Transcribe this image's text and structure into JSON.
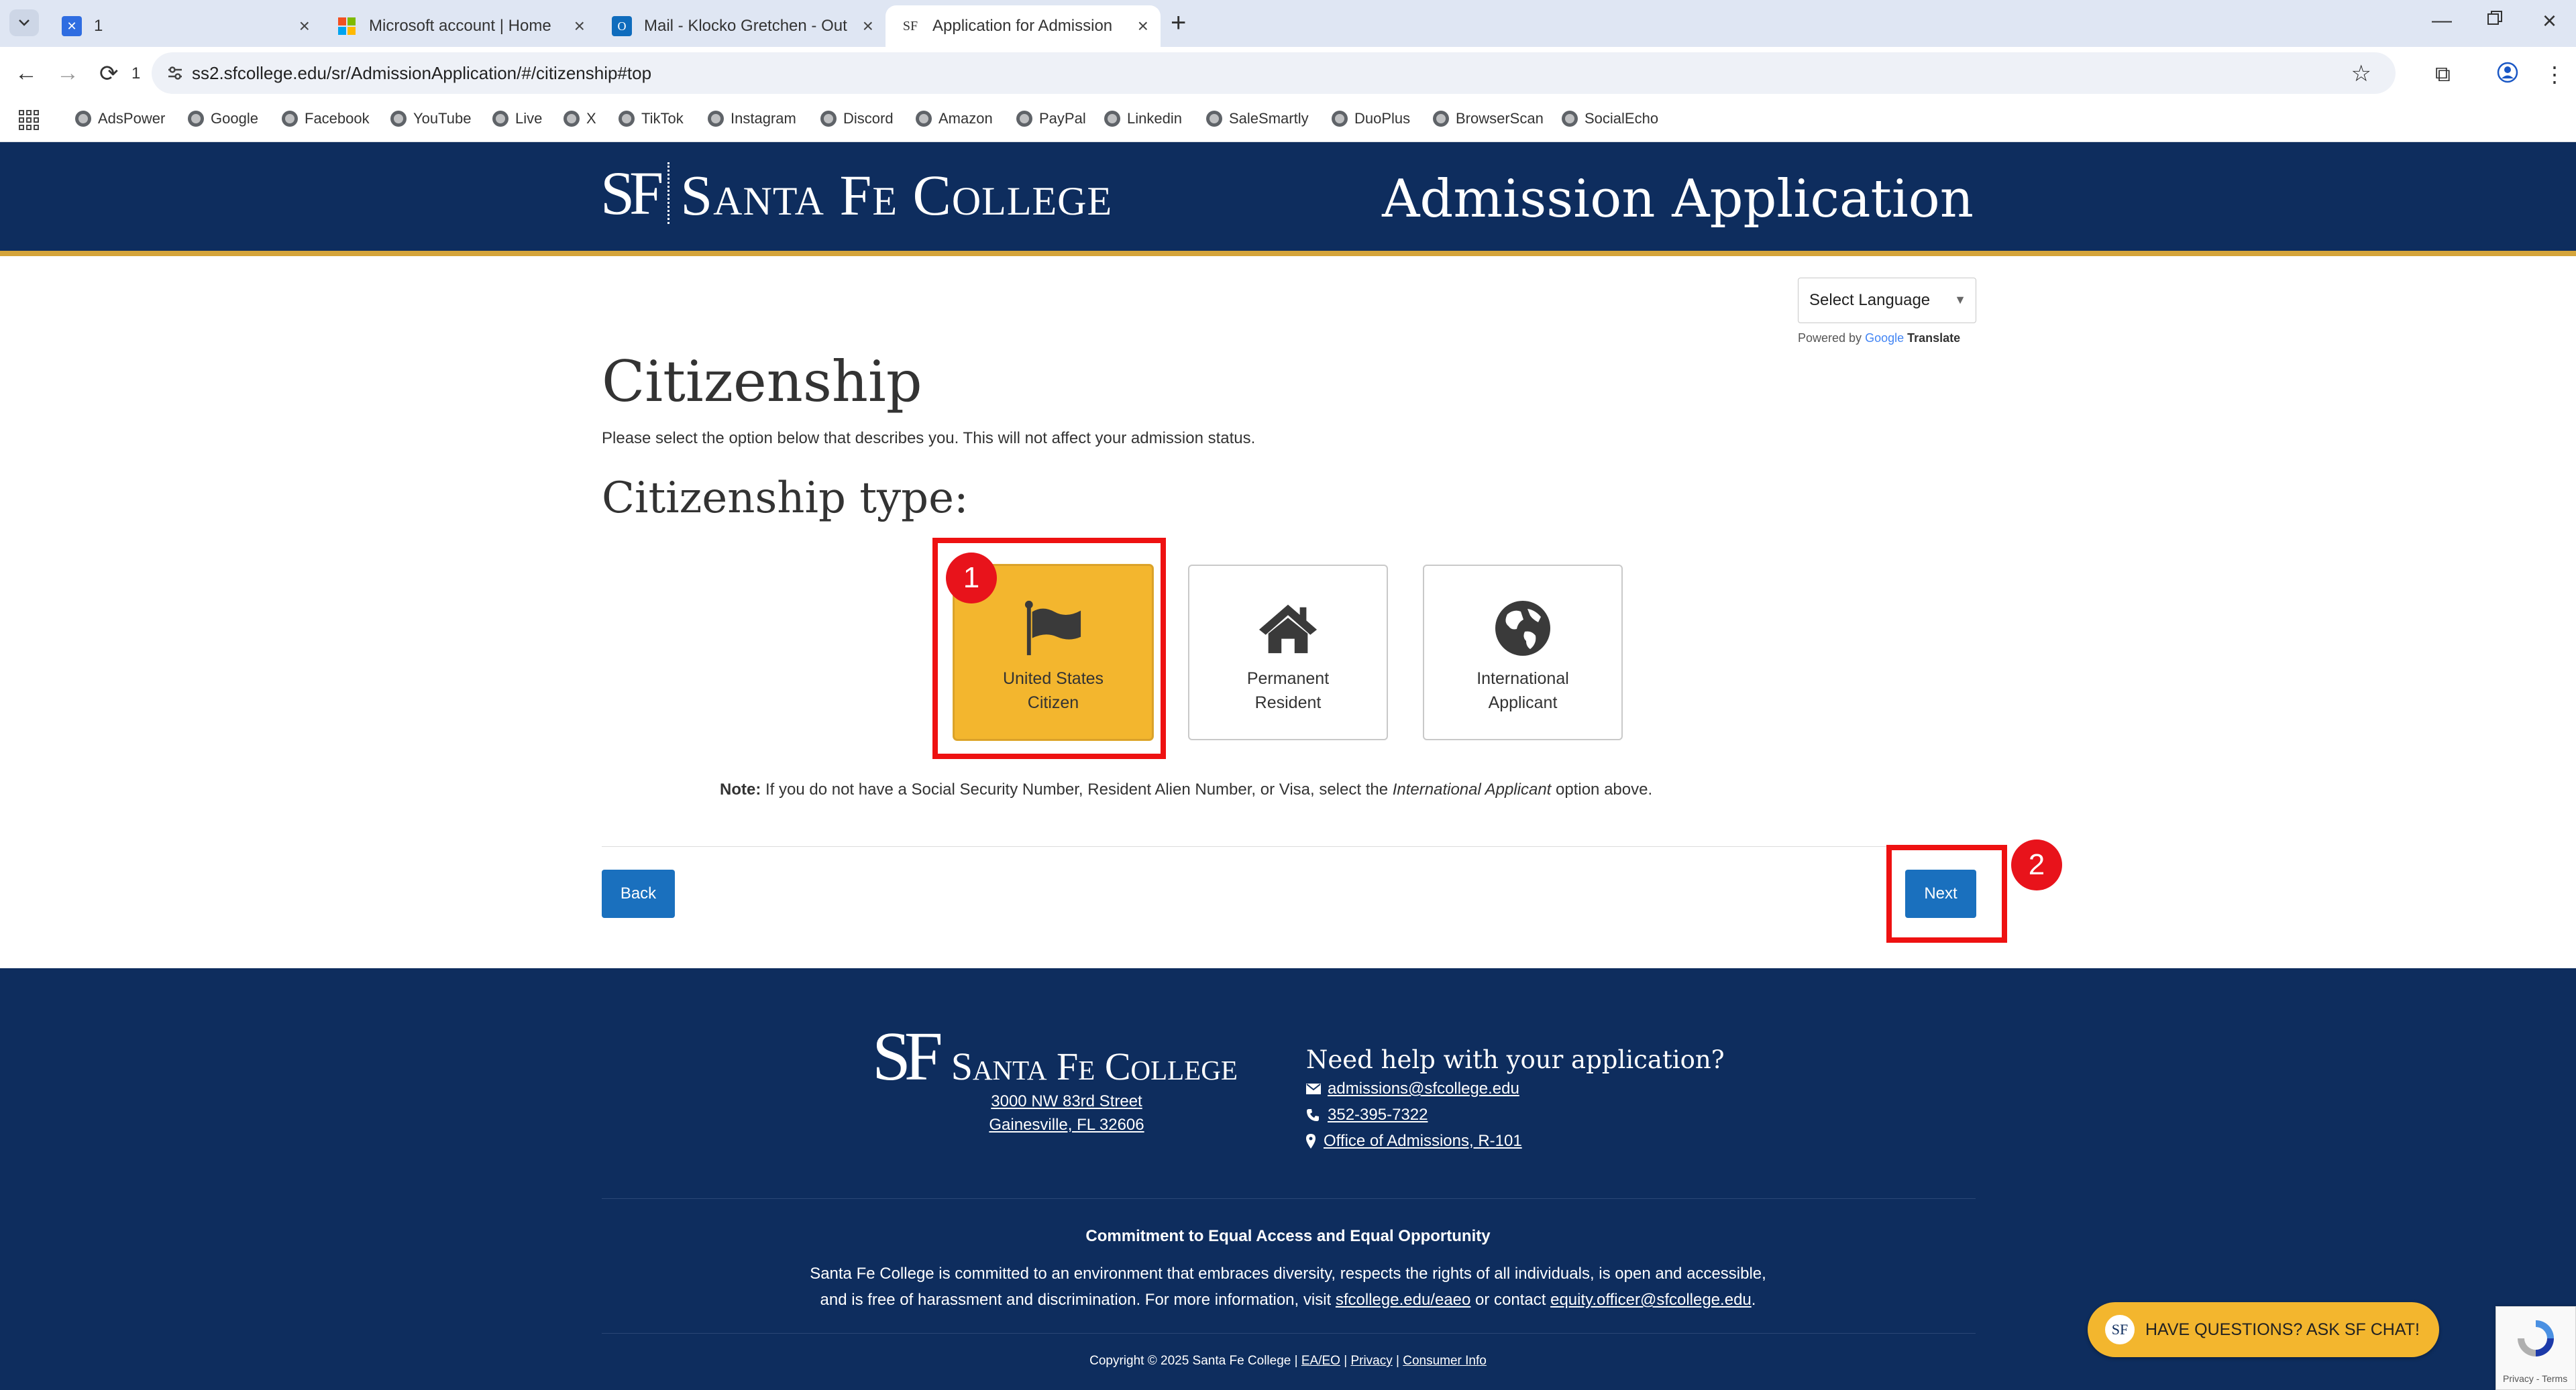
{
  "browser": {
    "tabs": [
      {
        "label": "1",
        "favicon": "app-icon"
      },
      {
        "label": "Microsoft account | Home",
        "favicon": "microsoft-icon"
      },
      {
        "label": "Mail - Klocko Gretchen - Out",
        "favicon": "outlook-icon"
      },
      {
        "label": "Application for Admission",
        "favicon": "sf-icon",
        "active": true
      }
    ],
    "reload_count": "1",
    "url": "ss2.sfcollege.edu/sr/AdmissionApplication/#/citizenship#top",
    "bookmarks": [
      "AdsPower",
      "Google",
      "Facebook",
      "YouTube",
      "Live",
      "X",
      "TikTok",
      "Instagram",
      "Discord",
      "Amazon",
      "PayPal",
      "Linkedin",
      "SaleSmartly",
      "DuoPlus",
      "BrowserScan",
      "SocialEcho"
    ]
  },
  "header": {
    "logo_mark": "SF",
    "logo_text": "Santa Fe College",
    "title": "Admission Application"
  },
  "language": {
    "select_label": "Select Language",
    "powered_prefix": "Powered by",
    "powered_google": "Google",
    "powered_translate": "Translate"
  },
  "main": {
    "title": "Citizenship",
    "intro": "Please select the option below that describes you. This will not affect your admission status.",
    "subtitle": "Citizenship type:",
    "options": [
      {
        "line1": "United States",
        "line2": "Citizen",
        "icon": "flag-icon",
        "selected": true
      },
      {
        "line1": "Permanent",
        "line2": "Resident",
        "icon": "home-icon",
        "selected": false
      },
      {
        "line1": "International",
        "line2": "Applicant",
        "icon": "globe-icon",
        "selected": false
      }
    ],
    "note_label": "Note:",
    "note_text_before": "If you do not have a Social Security Number, Resident Alien Number, or Visa, select the",
    "note_emphasis": "International Applicant",
    "note_text_after": "option above.",
    "back_label": "Back",
    "next_label": "Next"
  },
  "annotations": {
    "badge1": "1",
    "badge2": "2"
  },
  "footer": {
    "logo_mark": "SF",
    "logo_text": "Santa Fe College",
    "address_line1": "3000 NW 83rd Street",
    "address_line2": "Gainesville, FL 32606",
    "help_title": "Need help with your application?",
    "email": "admissions@sfcollege.edu",
    "phone": "352-395-7322",
    "office": "Office of Admissions, R-101",
    "commitment_title": "Commitment to Equal Access and Equal Opportunity",
    "commitment_line1": "Santa Fe College is committed to an environment that embraces diversity, respects the rights of all individuals, is open and accessible,",
    "commitment_line2_before": "and is free of harassment and discrimination. For more information, visit",
    "commitment_link1": "sfcollege.edu/eaeo",
    "commitment_line2_mid": "or contact",
    "commitment_link2": "equity.officer@sfcollege.edu",
    "commitment_line2_after": ".",
    "copyright": "Copyright © 2025 Santa Fe College |",
    "link_eaeo": "EA/EO",
    "link_privacy": "Privacy",
    "link_consumer": "Consumer Info",
    "sep": "|"
  },
  "chat": {
    "icon_text": "SF",
    "label": "HAVE QUESTIONS? ASK SF CHAT!"
  },
  "recaptcha": {
    "text": "Privacy - Terms"
  },
  "colors": {
    "navy": "#0e2d5e",
    "gold": "#f3b62e",
    "button_blue": "#1a70be",
    "highlight_red": "#ee1111"
  }
}
